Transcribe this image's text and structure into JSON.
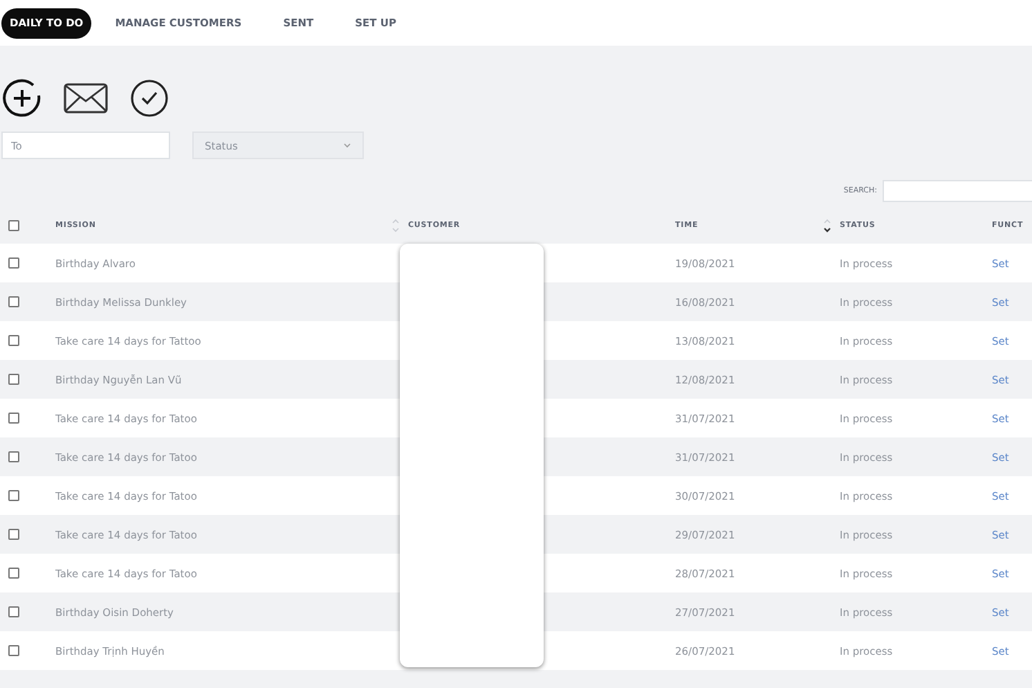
{
  "nav": {
    "tabs": [
      {
        "label": "DAILY TO DO",
        "selected": true
      },
      {
        "label": "MANAGE CUSTOMERS",
        "selected": false
      },
      {
        "label": "SENT",
        "selected": false
      },
      {
        "label": "SET UP",
        "selected": false
      }
    ]
  },
  "filters": {
    "to": {
      "placeholder": "To"
    },
    "status": {
      "placeholder": "Status"
    }
  },
  "search": {
    "label": "SEARCH:"
  },
  "table": {
    "columns": [
      "MISSION",
      "CUSTOMER",
      "TIME",
      "STATUS",
      "FUNCT"
    ],
    "select_all": {
      "checked": false
    },
    "rows": [
      {
        "mission": "Birthday Alvaro",
        "time": "19/08/2021",
        "status": "In process",
        "action": "Set",
        "checked": false
      },
      {
        "mission": "Birthday Melissa Dunkley",
        "time": "16/08/2021",
        "status": "In process",
        "action": "Set",
        "checked": false
      },
      {
        "mission": "Take care 14 days for Tattoo",
        "time": "13/08/2021",
        "status": "In process",
        "action": "Set",
        "checked": false
      },
      {
        "mission": "Birthday Nguyễn Lan Vũ",
        "time": "12/08/2021",
        "status": "In process",
        "action": "Set",
        "checked": false
      },
      {
        "mission": "Take care 14 days for Tatoo",
        "time": "31/07/2021",
        "status": "In process",
        "action": "Set",
        "checked": false
      },
      {
        "mission": "Take care 14 days for Tatoo",
        "time": "31/07/2021",
        "status": "In process",
        "action": "Set",
        "checked": false
      },
      {
        "mission": "Take care 14 days for Tatoo",
        "time": "30/07/2021",
        "status": "In process",
        "action": "Set",
        "checked": false
      },
      {
        "mission": "Take care 14 days for Tatoo",
        "time": "29/07/2021",
        "status": "In process",
        "action": "Set",
        "checked": false
      },
      {
        "mission": "Take care 14 days for Tatoo",
        "time": "28/07/2021",
        "status": "In process",
        "action": "Set",
        "checked": false
      },
      {
        "mission": "Birthday Oisin Doherty",
        "time": "27/07/2021",
        "status": "In process",
        "action": "Set",
        "checked": false
      },
      {
        "mission": "Birthday Trịnh Huyền",
        "time": "26/07/2021",
        "status": "In process",
        "action": "Set",
        "checked": false
      }
    ]
  }
}
